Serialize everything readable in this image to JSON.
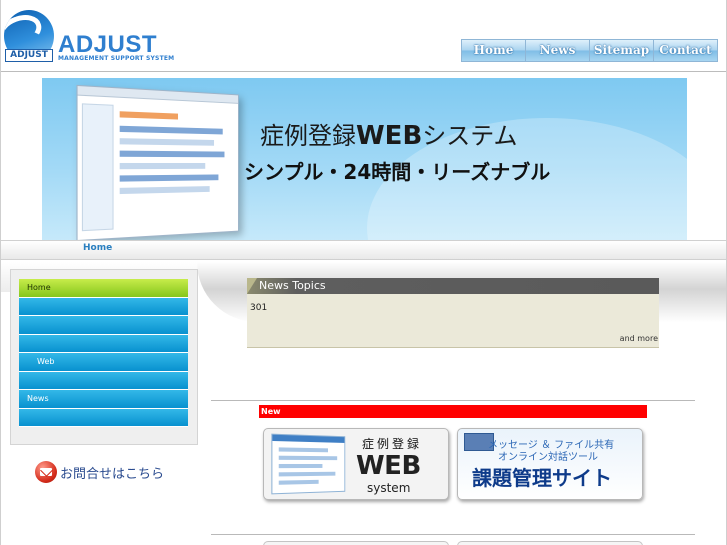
{
  "header": {
    "logo_badge": "ADJUST",
    "logo_text": "ADJUST",
    "logo_sub": "MANAGEMENT SUPPORT SYSTEM",
    "nav": [
      "Home",
      "News",
      "Sitemap",
      "Contact"
    ]
  },
  "banner": {
    "title_prefix": "症例登録",
    "title_web": "WEB",
    "title_suffix": "システム",
    "subtitle": "シンプル・24時間・リーズナブル"
  },
  "breadcrumb": "Home",
  "sidebar": {
    "items": [
      {
        "label": "Home",
        "active": true
      },
      {
        "label": ""
      },
      {
        "label": ""
      },
      {
        "label": ""
      },
      {
        "label": "Web"
      },
      {
        "label": ""
      },
      {
        "label": "News"
      },
      {
        "label": ""
      }
    ],
    "contact_label": "お問合せはこちら"
  },
  "news": {
    "header": "News Topics",
    "body": "301",
    "more": "and more"
  },
  "new_label": "New",
  "promos": {
    "web": {
      "line1": "症例登録",
      "line2": "WEB",
      "line3": "system"
    },
    "task": {
      "line1": "メッセージ ＆ ファイル共有",
      "line2": "オンライン対話ツール",
      "line3": "課題管理サイト"
    }
  },
  "colors": {
    "accent_blue": "#2f7fcf",
    "menu_blue": "#0891cf",
    "menu_active_green": "#85c61c",
    "new_red": "#ff0000",
    "news_header_grey": "#5a5a5a"
  }
}
